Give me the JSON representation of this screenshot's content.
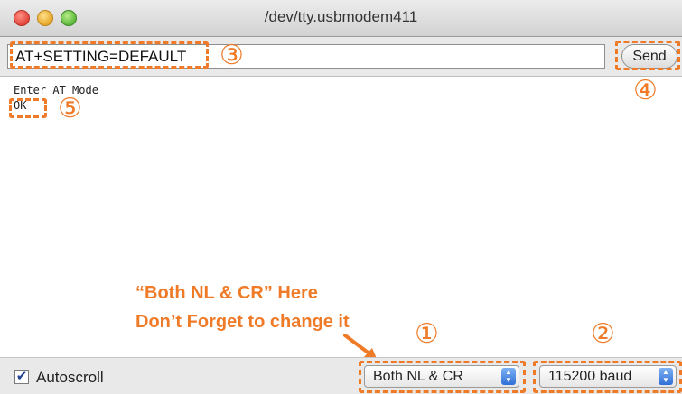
{
  "window": {
    "title": "/dev/tty.usbmodem411"
  },
  "toolbar": {
    "command_value": "AT+SETTING=DEFAULT",
    "send_label": "Send"
  },
  "serial_output": {
    "lines": [
      "Enter AT Mode",
      "OK"
    ]
  },
  "annotations": {
    "markers": [
      "①",
      "②",
      "③",
      "④",
      "⑤"
    ],
    "note_line1": "“Both NL & CR” Here",
    "note_line2": "Don’t Forget to change it",
    "color": "#ef7a27"
  },
  "statusbar": {
    "autoscroll_label": "Autoscroll",
    "autoscroll_checked": true,
    "line_ending": "Both NL & CR",
    "baud_rate": "115200 baud"
  },
  "icons": {
    "close": "close-button-icon",
    "minimize": "minimize-button-icon",
    "zoom": "zoom-button-icon",
    "check": "checkmark-icon",
    "stepper": "up-down-stepper-icon",
    "arrow": "annotation-arrow-icon"
  }
}
